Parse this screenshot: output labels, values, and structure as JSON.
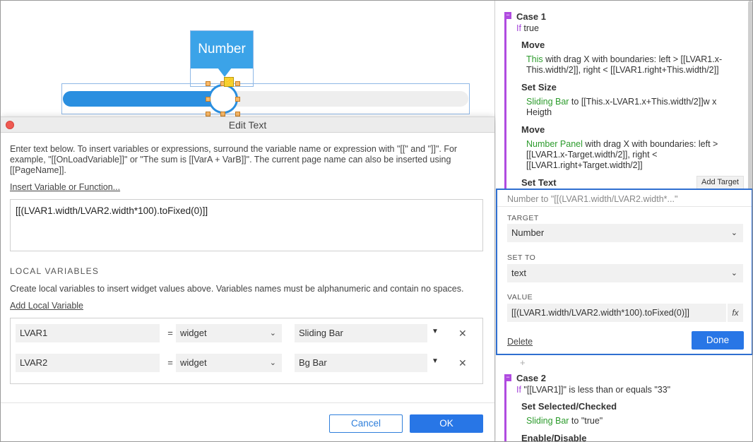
{
  "canvas": {
    "tooltip_label": "Number",
    "bolt_icon": "⚡"
  },
  "dialog": {
    "title": "Edit Text",
    "instructions": "Enter text below. To insert variables or expressions, surround the variable name or expression with \"[[\" and \"]]\". For example, \"[[OnLoadVariable]]\" or \"The sum is [[VarA + VarB]]\". The current page name can also be inserted using [[PageName]].",
    "insert_link": "Insert Variable or Function...",
    "expression": "[[(LVAR1.width/LVAR2.width*100).toFixed(0)]]",
    "local_vars_header": "LOCAL VARIABLES",
    "local_vars_desc": "Create local variables to insert widget values above. Variables names must be alphanumeric and contain no spaces.",
    "add_local_link": "Add Local Variable",
    "rows": [
      {
        "name": "LVAR1",
        "eq": "=",
        "type": "widget",
        "widget": "Sliding Bar"
      },
      {
        "name": "LVAR2",
        "eq": "=",
        "type": "widget",
        "widget": "Bg Bar"
      }
    ],
    "cancel_label": "Cancel",
    "ok_label": "OK"
  },
  "panel": {
    "case1": {
      "title": "Case 1",
      "cond_if": "If",
      "cond_rest": " true",
      "actions": {
        "move1_title": "Move",
        "move1_target": "This",
        "move1_body": " with drag X  with boundaries: left > [[LVAR1.x-This.width/2]], right < [[LVAR1.right+This.width/2]]",
        "setsize_title": "Set Size",
        "setsize_target": "Sliding Bar",
        "setsize_body": " to [[This.x-LVAR1.x+This.width/2]]w x Heigth",
        "move2_title": "Move",
        "move2_target": "Number Panel",
        "move2_body": " with drag X  with boundaries: left > [[LVAR1.x-Target.width/2]], right < [[LVAR1.right+Target.width/2]]",
        "settext_title": "Set Text"
      },
      "add_target": "Add Target"
    },
    "editor": {
      "summary": "Number to \"[[(LVAR1.width/LVAR2.width*...\"",
      "target_label": "TARGET",
      "target_value": "Number",
      "setto_label": "SET TO",
      "setto_value": "text",
      "value_label": "VALUE",
      "value_text": "[[(LVAR1.width/LVAR2.width*100).toFixed(0)]]",
      "fx": "fx",
      "delete_label": "Delete",
      "done_label": "Done"
    },
    "plus": "+",
    "case2": {
      "title": "Case 2",
      "cond_if": "If",
      "cond_rest": " \"[[LVAR1]]\" is less than or equals \"33\"",
      "act1_title": "Set Selected/Checked",
      "act1_target": "Sliding Bar",
      "act1_body": " to \"true\"",
      "act2_title": "Enable/Disable"
    },
    "colors": {
      "accent": "#2876e6",
      "case": "#b04be0",
      "target": "#2c9b2c",
      "slider": "#2a8fe0"
    }
  }
}
